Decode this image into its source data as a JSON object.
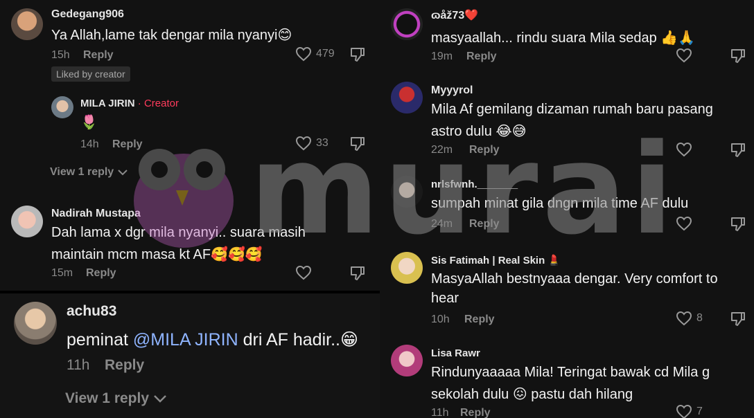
{
  "left_top": {
    "c1": {
      "username": "Gedegang906",
      "text": "Ya Allah,lame tak dengar mila nyanyi",
      "emoji": "😊",
      "time": "15h",
      "reply": "Reply",
      "likes": "479",
      "badge": "Liked by creator"
    },
    "c1_reply": {
      "username": "MILA JIRIN",
      "creator_sep": " · ",
      "creator_label": "Creator",
      "emoji": "🌷",
      "time": "14h",
      "reply": "Reply",
      "likes": "33"
    },
    "c1_view_replies": "View 1 reply",
    "c2": {
      "username": "Nadirah Mustapa",
      "text_line1": "Dah lama x dgr mila nyanyi.. suara masih",
      "text_line2": "maintain mcm masa kt AF",
      "emoji": "🥰🥰🥰",
      "time": "15m",
      "reply": "Reply"
    }
  },
  "left_bottom": {
    "c3": {
      "username": "achu83",
      "text_prefix": "peminat ",
      "mention": "@MILA JIRIN",
      "text_suffix": " dri AF hadir..",
      "emoji": "😁",
      "time": "11h",
      "reply": "Reply"
    },
    "view_replies": "View 1 reply"
  },
  "right": {
    "c1": {
      "username": "ɷåž73",
      "user_emoji": "❤️",
      "text": "masyaallah... rindu suara Mila sedap ",
      "emoji": "👍🙏",
      "time": "19m",
      "reply": "Reply"
    },
    "c2": {
      "username": "Myyyrol",
      "text_line1": "Mila Af gemilang dizaman rumah baru pasang",
      "text_line2": "astro dulu ",
      "emoji": "😂😅",
      "time": "22m",
      "reply": "Reply"
    },
    "c3": {
      "username": "nrlsfwnh._______",
      "text": "sumpah minat gila dngn mila time AF dulu",
      "time": "24m",
      "reply": "Reply"
    },
    "c4": {
      "username": "Sis Fatimah | Real Skin ",
      "user_emoji": "💄",
      "text_line1": "MasyaAllah bestnyaaa dengar. Very comfort to",
      "text_line2": "hear",
      "time": "10h",
      "reply": "Reply",
      "likes": "8"
    },
    "c5": {
      "username": "Lisa Rawr",
      "text_line1": "Rindunyaaaaa Mila! Teringat bawak cd Mila g",
      "text_line2_a": "sekolah dulu ",
      "emoji": "😖",
      "text_line2_b": " pastu dah hilang",
      "time": "11h",
      "reply": "Reply",
      "likes": "7"
    }
  },
  "watermark": {
    "text": "murai"
  },
  "colors": {
    "background": "#121212",
    "muted": "#8a8a8a",
    "creator": "#ff3b5c",
    "mention": "#8fb4ff"
  }
}
